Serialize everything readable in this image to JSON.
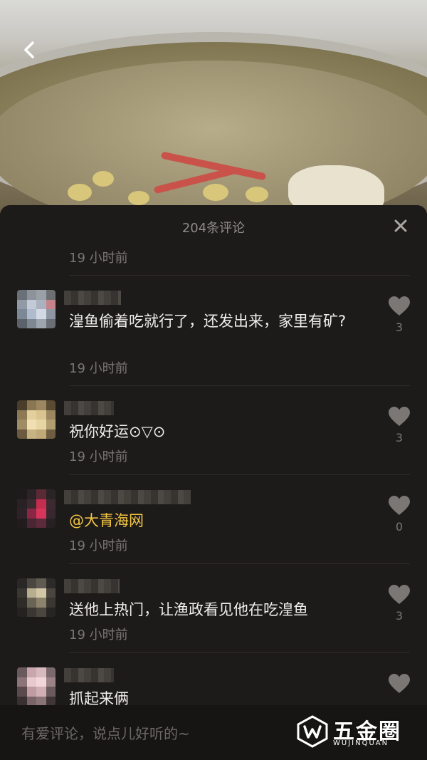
{
  "header": {
    "title": "204条评论"
  },
  "partial": {
    "time": "19 小时前"
  },
  "comments": [
    {
      "text": "湟鱼偷着吃就行了，还发出来，家里有矿?",
      "time": "19 小时前",
      "likes": "3"
    },
    {
      "text": "祝你好运⊙▽⊙",
      "time": "19 小时前",
      "likes": "3"
    },
    {
      "text": "@大青海网",
      "time": "19 小时前",
      "likes": "0"
    },
    {
      "text": "送他上热门，让渔政看见他在吃湟鱼",
      "time": "19 小时前",
      "likes": "3"
    },
    {
      "text": "抓起来俩",
      "time": "",
      "likes": ""
    }
  ],
  "input": {
    "placeholder": "有爱评论，说点儿好听的~"
  },
  "watermark": {
    "brand": "五金圈",
    "sub": "WUJINQUAN"
  },
  "colors": {
    "mention": "#f3c544",
    "panel": "#1d1b19"
  },
  "icons": [
    "back-arrow-icon",
    "close-icon",
    "heart-icon",
    "watermark-logo-icon"
  ]
}
